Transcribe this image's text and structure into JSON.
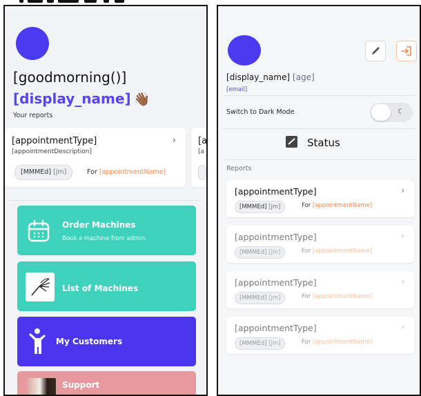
{
  "left": {
    "greeting": "[goodmorning()]",
    "display_name": "[display_name]",
    "wave_emoji": "👋🏾",
    "your_reports": "Your reports",
    "report_card": {
      "title": "[appointmentType]",
      "description": "[appointmentDescription]",
      "date": "[MMMEd]",
      "time": "[jm]",
      "for_label": "For",
      "appointment_name": "[appointmentName]",
      "peek_title": "[a",
      "peek_desc": "[a"
    },
    "tiles": [
      {
        "label": "Order Machines",
        "subtitle": "Book a machine from admin.",
        "color": "#3ed1bb",
        "icon": "calendar-icon"
      },
      {
        "label": "List of Machines",
        "subtitle": "",
        "color": "#3ed1bb",
        "icon": "fan-icon"
      },
      {
        "label": "My Customers",
        "subtitle": "",
        "color": "#4b35ee",
        "icon": "person-icon"
      },
      {
        "label": "Support",
        "subtitle": "",
        "color": "#e69a9d",
        "icon": "support-photo"
      }
    ]
  },
  "right": {
    "display_name": "[display_name]",
    "age": "[age]",
    "email": "[email]",
    "dark_mode_label": "Switch to Dark Mode",
    "status_label": "Status",
    "reports_label": "Reports",
    "reports": [
      {
        "title": "[appointmentType]",
        "date": "[MMMEd]",
        "time": "[jm]",
        "for_label": "For",
        "appointment_name": "[appointmentName]"
      },
      {
        "title": "[appointmentType]",
        "date": "[MMMEd]",
        "time": "[jm]",
        "for_label": "For",
        "appointment_name": "[appointmentName]"
      },
      {
        "title": "[appointmentType]",
        "date": "[MMMEd]",
        "time": "[jm]",
        "for_label": "For",
        "appointment_name": "[appointmentName]"
      },
      {
        "title": "[appointmentType]",
        "date": "[MMMEd]",
        "time": "[jm]",
        "for_label": "For",
        "appointment_name": "[appointmentName]"
      }
    ]
  },
  "colors": {
    "accent": "#5b43f1",
    "teal": "#3ed1bb",
    "orange": "#f0884e",
    "avatar": "#4a3af0"
  }
}
